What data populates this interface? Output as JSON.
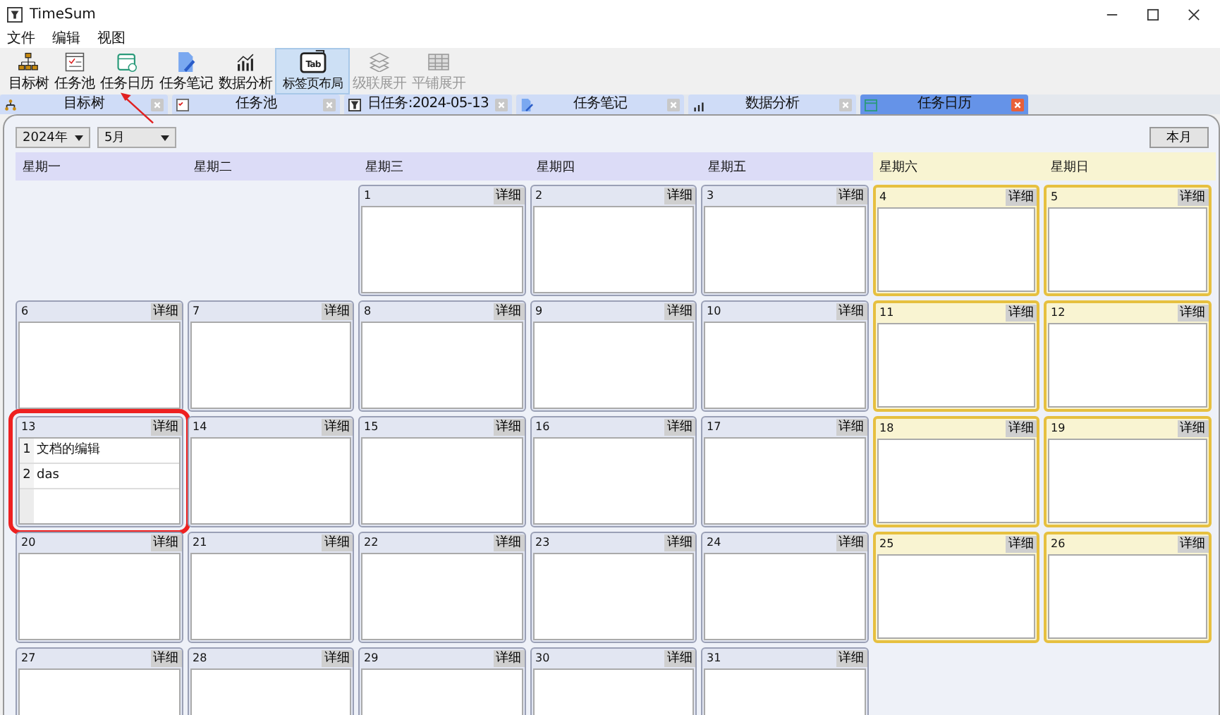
{
  "window": {
    "title": "TimeSum"
  },
  "menu": [
    "文件",
    "编辑",
    "视图"
  ],
  "toolbar": [
    {
      "kind": "tree",
      "label": "目标树",
      "selected": false,
      "disabled": false,
      "marked": false
    },
    {
      "kind": "pool",
      "label": "任务池",
      "selected": false,
      "disabled": false,
      "marked": false
    },
    {
      "kind": "calendar",
      "label": "任务日历",
      "selected": false,
      "disabled": false,
      "marked": true
    },
    {
      "kind": "note",
      "label": "任务笔记",
      "selected": false,
      "disabled": false,
      "marked": false
    },
    {
      "kind": "chart",
      "label": "数据分析",
      "selected": false,
      "disabled": false,
      "marked": false
    },
    {
      "kind": "tab",
      "label": "标签页布局",
      "icon_label": "Tab",
      "selected": true,
      "disabled": false,
      "marked": false
    },
    {
      "kind": "layers",
      "label": "级联展开",
      "selected": false,
      "disabled": true,
      "marked": false
    },
    {
      "kind": "grid",
      "label": "平铺展开",
      "selected": false,
      "disabled": true,
      "marked": false
    }
  ],
  "tabs": [
    {
      "kind": "tree",
      "label": "目标树",
      "selected": false
    },
    {
      "kind": "pool",
      "label": "任务池",
      "selected": false
    },
    {
      "kind": "day",
      "label": "日任务:2024-05-13",
      "selected": false
    },
    {
      "kind": "note",
      "label": "任务笔记",
      "selected": false
    },
    {
      "kind": "chart",
      "label": "数据分析",
      "selected": false
    },
    {
      "kind": "calendar",
      "label": "任务日历",
      "selected": true
    }
  ],
  "calendar": {
    "year": "2024年",
    "month": "5月",
    "today_button": "本月",
    "weekdays": [
      {
        "label": "星期一",
        "weekend": false
      },
      {
        "label": "星期二",
        "weekend": false
      },
      {
        "label": "星期三",
        "weekend": false
      },
      {
        "label": "星期四",
        "weekend": false
      },
      {
        "label": "星期五",
        "weekend": false
      },
      {
        "label": "星期六",
        "weekend": true
      },
      {
        "label": "星期日",
        "weekend": true
      }
    ],
    "weeks": [
      [
        {
          "kind": "empty"
        },
        {
          "kind": "empty"
        },
        {
          "kind": "day",
          "day": "1",
          "button": "详细",
          "highlighted": false
        },
        {
          "kind": "day",
          "day": "2",
          "button": "详细",
          "highlighted": false
        },
        {
          "kind": "day",
          "day": "3",
          "button": "详细",
          "highlighted": false
        },
        {
          "kind": "day",
          "day": "4",
          "button": "详细",
          "highlighted": false
        },
        {
          "kind": "day",
          "day": "5",
          "button": "详细",
          "highlighted": false
        }
      ],
      [
        {
          "kind": "day",
          "day": "6",
          "button": "详细",
          "highlighted": false
        },
        {
          "kind": "day",
          "day": "7",
          "button": "详细",
          "highlighted": false
        },
        {
          "kind": "day",
          "day": "8",
          "button": "详细",
          "highlighted": false
        },
        {
          "kind": "day",
          "day": "9",
          "button": "详细",
          "highlighted": false
        },
        {
          "kind": "day",
          "day": "10",
          "button": "详细",
          "highlighted": false
        },
        {
          "kind": "day",
          "day": "11",
          "button": "详细",
          "highlighted": false
        },
        {
          "kind": "day",
          "day": "12",
          "button": "详细",
          "highlighted": false
        }
      ],
      [
        {
          "kind": "day",
          "day": "13",
          "button": "详细",
          "highlighted": true,
          "tasks": [
            {
              "index": "1",
              "text": "文档的编辑"
            },
            {
              "index": "2",
              "text": "das"
            }
          ]
        },
        {
          "kind": "day",
          "day": "14",
          "button": "详细",
          "highlighted": false
        },
        {
          "kind": "day",
          "day": "15",
          "button": "详细",
          "highlighted": false
        },
        {
          "kind": "day",
          "day": "16",
          "button": "详细",
          "highlighted": false
        },
        {
          "kind": "day",
          "day": "17",
          "button": "详细",
          "highlighted": false
        },
        {
          "kind": "day",
          "day": "18",
          "button": "详细",
          "highlighted": false
        },
        {
          "kind": "day",
          "day": "19",
          "button": "详细",
          "highlighted": false
        }
      ],
      [
        {
          "kind": "day",
          "day": "20",
          "button": "详细",
          "highlighted": false
        },
        {
          "kind": "day",
          "day": "21",
          "button": "详细",
          "highlighted": false
        },
        {
          "kind": "day",
          "day": "22",
          "button": "详细",
          "highlighted": false
        },
        {
          "kind": "day",
          "day": "23",
          "button": "详细",
          "highlighted": false
        },
        {
          "kind": "day",
          "day": "24",
          "button": "详细",
          "highlighted": false
        },
        {
          "kind": "day",
          "day": "25",
          "button": "详细",
          "highlighted": false
        },
        {
          "kind": "day",
          "day": "26",
          "button": "详细",
          "highlighted": false
        }
      ],
      [
        {
          "kind": "day",
          "day": "27",
          "button": "详细",
          "highlighted": false
        },
        {
          "kind": "day",
          "day": "28",
          "button": "详细",
          "highlighted": false
        },
        {
          "kind": "day",
          "day": "29",
          "button": "详细",
          "highlighted": false
        },
        {
          "kind": "day",
          "day": "30",
          "button": "详细",
          "highlighted": false
        },
        {
          "kind": "day",
          "day": "31",
          "button": "详细",
          "highlighted": false
        },
        {
          "kind": "empty"
        },
        {
          "kind": "empty"
        }
      ]
    ]
  }
}
